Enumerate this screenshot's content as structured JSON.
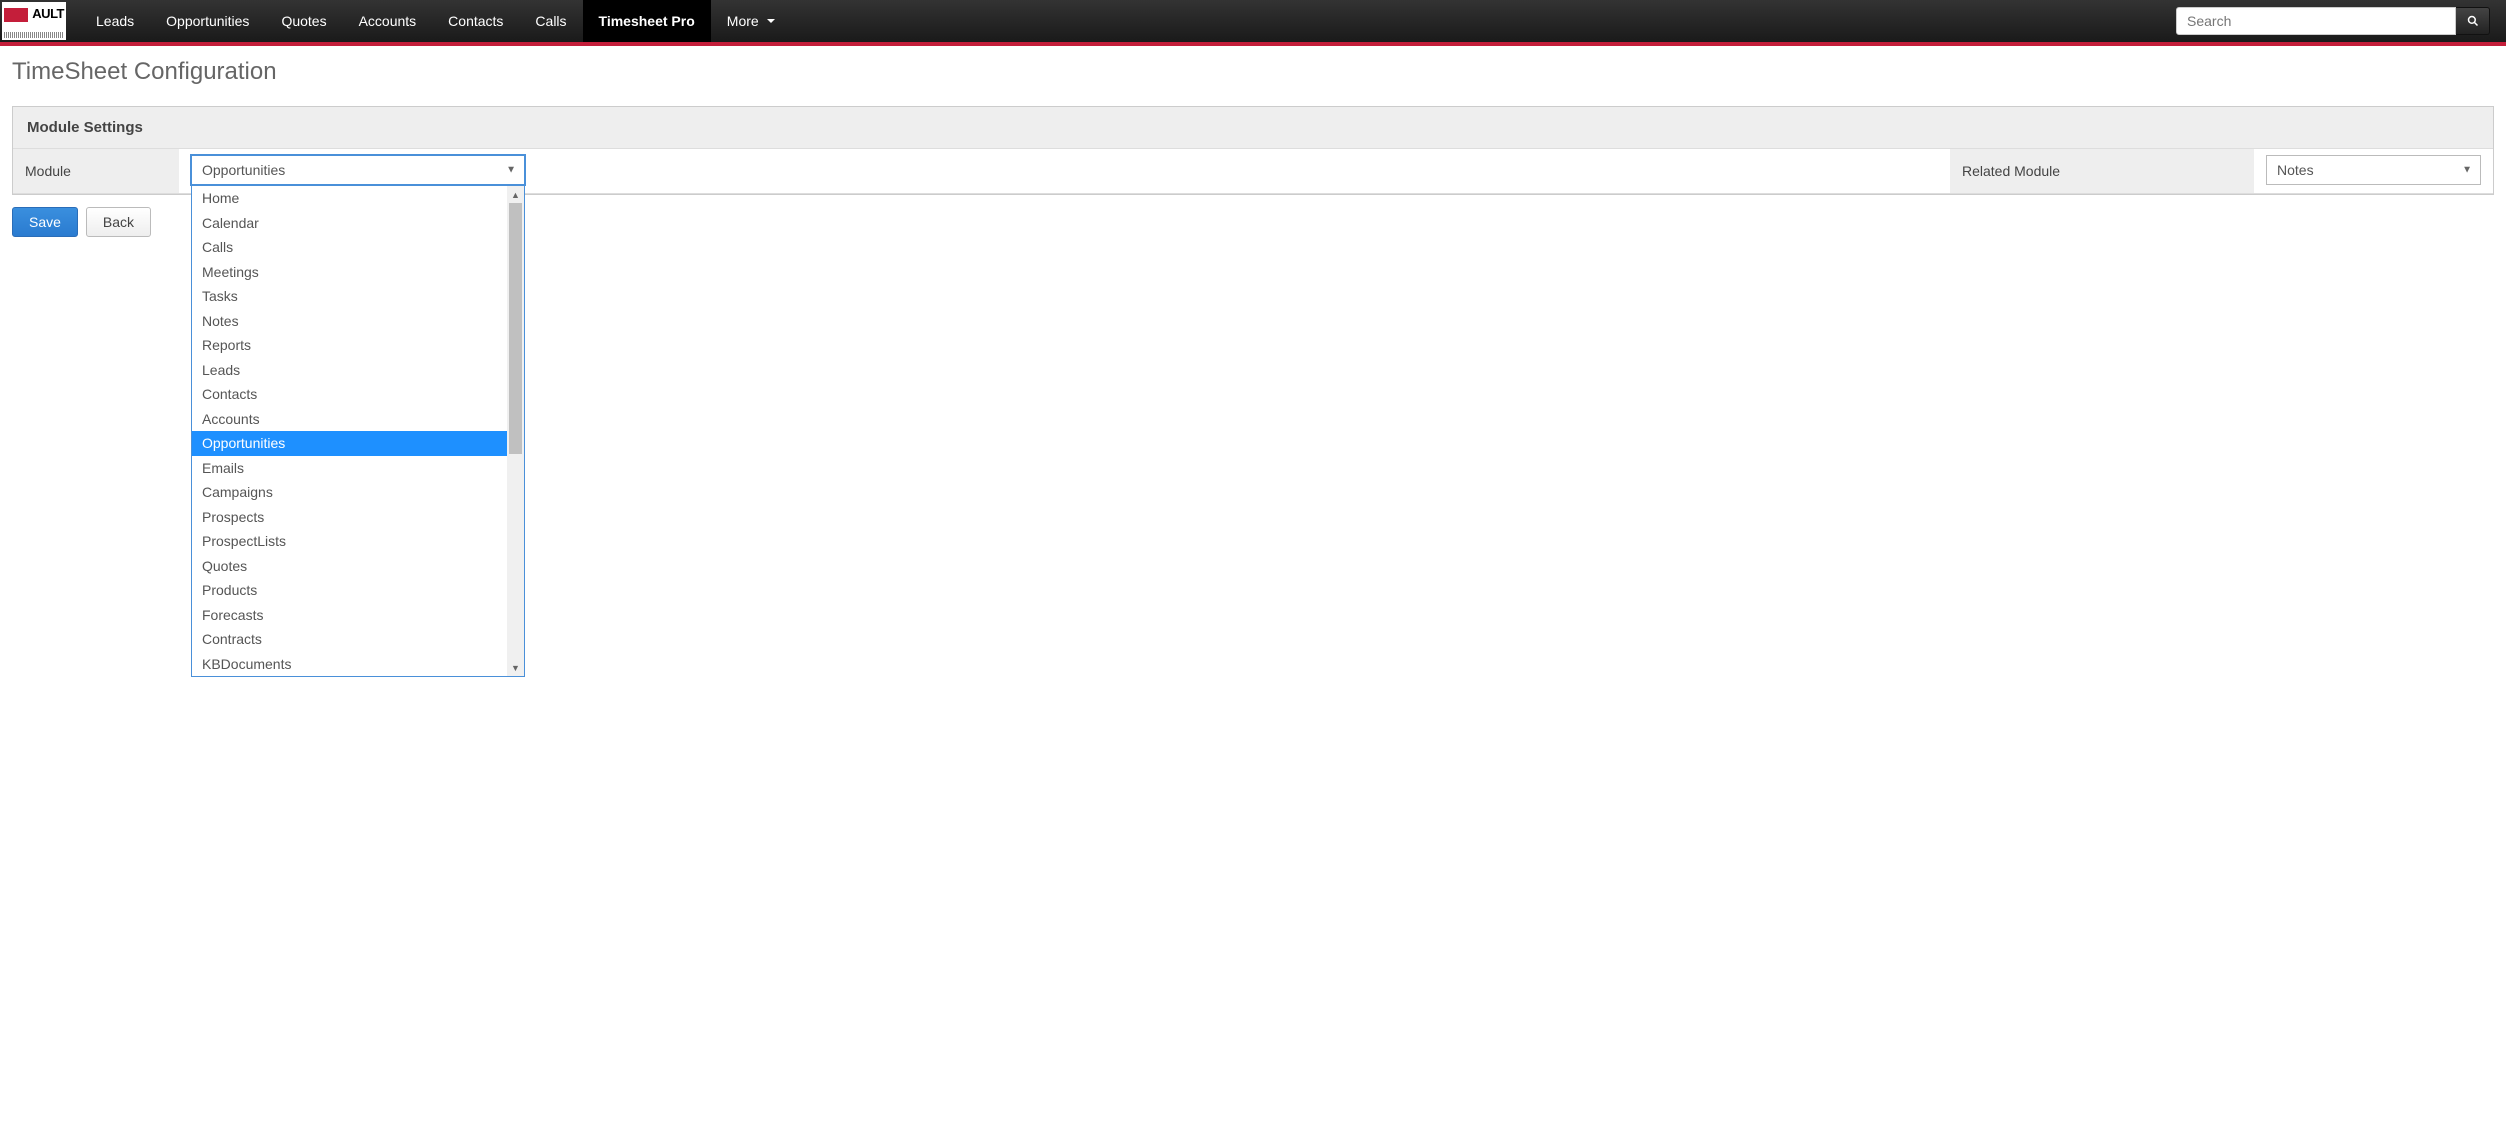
{
  "logo_text": "AULT",
  "nav": {
    "items": [
      "Leads",
      "Opportunities",
      "Quotes",
      "Accounts",
      "Contacts",
      "Calls",
      "Timesheet Pro",
      "More"
    ],
    "active_index": 6
  },
  "search": {
    "placeholder": "Search"
  },
  "page": {
    "title": "TimeSheet Configuration"
  },
  "panel": {
    "header": "Module Settings",
    "module_label": "Module",
    "module_value": "Opportunities",
    "module_options": [
      "Home",
      "Calendar",
      "Calls",
      "Meetings",
      "Tasks",
      "Notes",
      "Reports",
      "Leads",
      "Contacts",
      "Accounts",
      "Opportunities",
      "Emails",
      "Campaigns",
      "Prospects",
      "ProspectLists",
      "Quotes",
      "Products",
      "Forecasts",
      "Contracts",
      "KBDocuments"
    ],
    "module_selected_index": 10,
    "related_label": "Related Module",
    "related_value": "Notes"
  },
  "buttons": {
    "save": "Save",
    "back": "Back"
  }
}
